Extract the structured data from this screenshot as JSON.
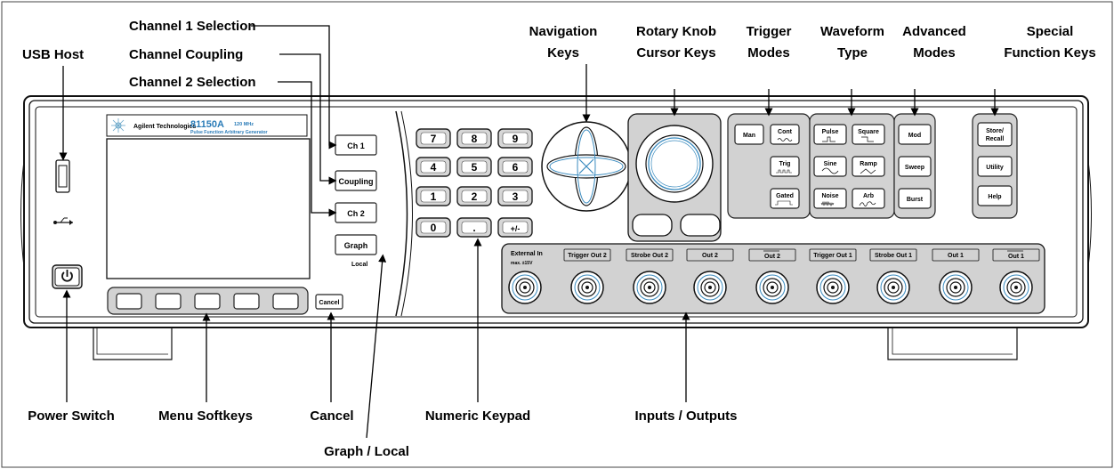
{
  "callouts": {
    "usb_host": "USB Host",
    "channel1": "Channel 1 Selection",
    "coupling": "Channel Coupling",
    "channel2": "Channel 2 Selection",
    "navigation_1": "Navigation",
    "navigation_2": "Keys",
    "rotary_1": "Rotary Knob",
    "rotary_2": "Cursor Keys",
    "trigger_1": "Trigger",
    "trigger_2": "Modes",
    "waveform_1": "Waveform",
    "waveform_2": "Type",
    "advanced_1": "Advanced",
    "advanced_2": "Modes",
    "special_1": "Special",
    "special_2": "Function Keys",
    "power": "Power Switch",
    "softkeys": "Menu Softkeys",
    "cancel": "Cancel",
    "keypad": "Numeric Keypad",
    "graph_local": "Graph / Local",
    "io": "Inputs / Outputs"
  },
  "instrument": {
    "brand": "Agilent Technologies",
    "model": "81150A",
    "spec": "120 MHz",
    "subtitle": "Pulse Function Arbitrary Generator"
  },
  "keys": {
    "ch1": "Ch 1",
    "coupling": "Coupling",
    "ch2": "Ch 2",
    "graph": "Graph",
    "local": "Local",
    "cancel": "Cancel",
    "numpad": [
      "7",
      "8",
      "9",
      "4",
      "5",
      "6",
      "1",
      "2",
      "3",
      "0",
      ".",
      "+/-"
    ],
    "man": "Man",
    "cont": "Cont",
    "trig": "Trig",
    "gated": "Gated",
    "pulse": "Pulse",
    "square": "Square",
    "sine": "Sine",
    "ramp": "Ramp",
    "noise": "Noise",
    "arb": "Arb",
    "mod": "Mod",
    "sweep": "Sweep",
    "burst": "Burst",
    "store_1": "Store/",
    "store_2": "Recall",
    "utility": "Utility",
    "help": "Help"
  },
  "connectors": {
    "external_in": "External In",
    "external_in_note": "max. ±15V",
    "trigger_out2": "Trigger Out 2",
    "strobe_out2": "Strobe Out 2",
    "out2": "Out 2",
    "out2_inv": "Out 2",
    "trigger_out1": "Trigger Out 1",
    "strobe_out1": "Strobe Out 1",
    "out1": "Out 1",
    "out1_inv": "Out 1"
  }
}
